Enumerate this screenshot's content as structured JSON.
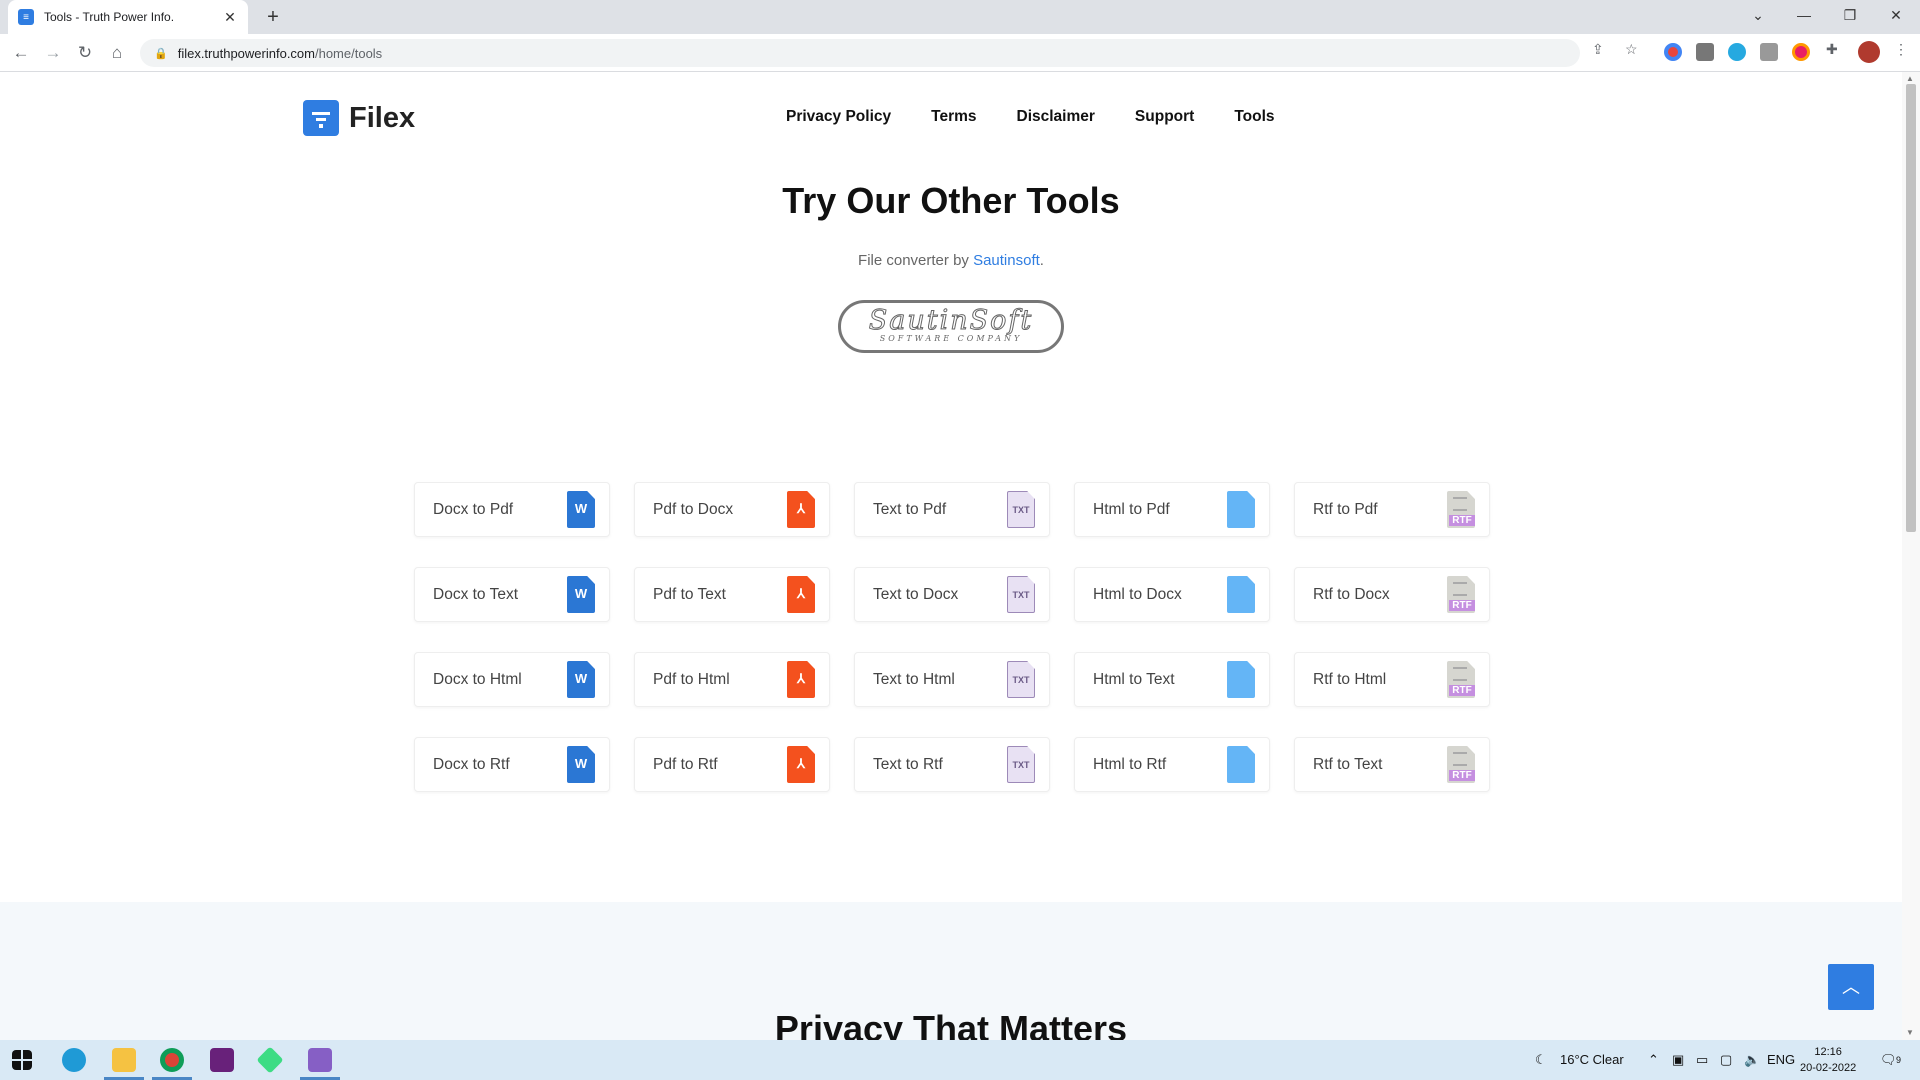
{
  "browser": {
    "tab_title": "Tools - Truth Power Info.",
    "tab_close": "✕",
    "new_tab": "+",
    "url_host": "filex.truthpowerinfo.com",
    "url_path": "/home/tools",
    "window_controls": {
      "list": "⌄",
      "minimize": "—",
      "restore": "❐",
      "close": "✕"
    }
  },
  "site": {
    "logo_text": "Filex",
    "nav": [
      "Privacy Policy",
      "Terms",
      "Disclaimer",
      "Support",
      "Tools"
    ]
  },
  "hero": {
    "title": "Try Our Other Tools",
    "subtitle_prefix": "File converter by ",
    "subtitle_link": "Sautinsoft",
    "subtitle_suffix": ".",
    "badge_main": "SautinSoft",
    "badge_sub": "SOFTWARE COMPANY"
  },
  "tools": [
    {
      "label": "Docx to Pdf",
      "icon": "word-icon"
    },
    {
      "label": "Pdf to Docx",
      "icon": "pdf-icon"
    },
    {
      "label": "Text to Pdf",
      "icon": "txt-icon"
    },
    {
      "label": "Html to Pdf",
      "icon": "html-icon"
    },
    {
      "label": "Rtf to Pdf",
      "icon": "rtf-icon"
    },
    {
      "label": "Docx to Text",
      "icon": "word-icon"
    },
    {
      "label": "Pdf to Text",
      "icon": "pdf-icon"
    },
    {
      "label": "Text to Docx",
      "icon": "txt-icon"
    },
    {
      "label": "Html to Docx",
      "icon": "html-icon"
    },
    {
      "label": "Rtf to Docx",
      "icon": "rtf-icon"
    },
    {
      "label": "Docx to Html",
      "icon": "word-icon"
    },
    {
      "label": "Pdf to Html",
      "icon": "pdf-icon"
    },
    {
      "label": "Text to Html",
      "icon": "txt-icon"
    },
    {
      "label": "Html to Text",
      "icon": "html-icon"
    },
    {
      "label": "Rtf to Html",
      "icon": "rtf-icon"
    },
    {
      "label": "Docx to Rtf",
      "icon": "word-icon"
    },
    {
      "label": "Pdf to Rtf",
      "icon": "pdf-icon"
    },
    {
      "label": "Text to Rtf",
      "icon": "txt-icon"
    },
    {
      "label": "Html to Rtf",
      "icon": "html-icon"
    },
    {
      "label": "Rtf to Text",
      "icon": "rtf-icon"
    }
  ],
  "section2": {
    "title": "Privacy That Matters"
  },
  "taskbar": {
    "weather": "16°C  Clear",
    "lang": "ENG",
    "time": "12:16",
    "date": "20-02-2022",
    "notifications": "9"
  },
  "colors": {
    "accent": "#2f7de1",
    "word": "#2b77d4",
    "pdf": "#f4511e",
    "html": "#64b5f6"
  }
}
